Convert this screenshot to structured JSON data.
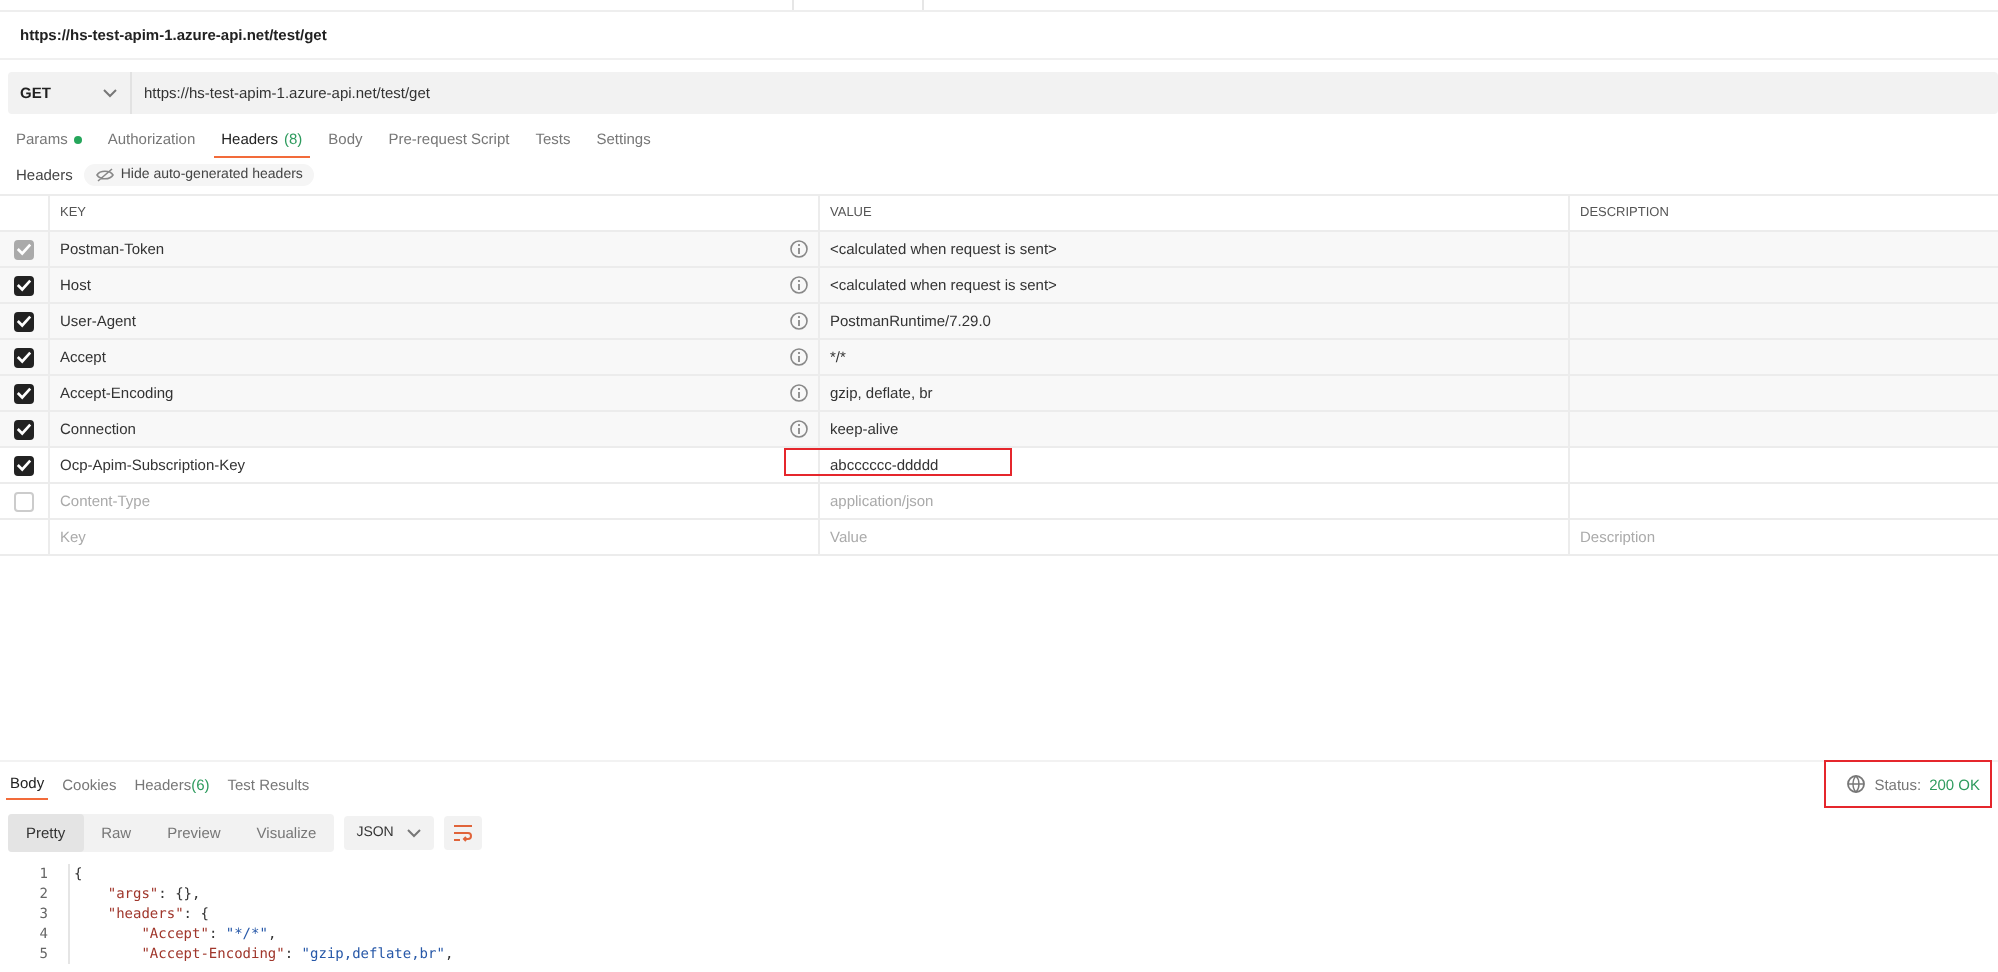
{
  "request_title": "https://hs-test-apim-1.azure-api.net/test/get",
  "url_bar": {
    "method": "GET",
    "url": "https://hs-test-apim-1.azure-api.net/test/get"
  },
  "request_tabs": [
    {
      "label": "Params",
      "dot": true,
      "selected": false
    },
    {
      "label": "Authorization",
      "dot": false,
      "selected": false
    },
    {
      "label": "Headers",
      "count": "(8)",
      "dot": false,
      "selected": true
    },
    {
      "label": "Body",
      "dot": false,
      "selected": false
    },
    {
      "label": "Pre-request Script",
      "dot": false,
      "selected": false
    },
    {
      "label": "Tests",
      "dot": false,
      "selected": false
    },
    {
      "label": "Settings",
      "dot": false,
      "selected": false
    }
  ],
  "headers_bar": {
    "label": "Headers",
    "toggle": "Hide auto-generated headers"
  },
  "table": {
    "columns": [
      "KEY",
      "VALUE",
      "DESCRIPTION"
    ],
    "rows": [
      {
        "key": "Postman-Token",
        "value": "<calculated when request is sent>",
        "checked": true,
        "disabled": true,
        "auto": true,
        "highlighted": false
      },
      {
        "key": "Host",
        "value": "<calculated when request is sent>",
        "checked": true,
        "disabled": false,
        "auto": true,
        "highlighted": false
      },
      {
        "key": "User-Agent",
        "value": "PostmanRuntime/7.29.0",
        "checked": true,
        "disabled": false,
        "auto": true,
        "highlighted": false
      },
      {
        "key": "Accept",
        "value": "*/*",
        "checked": true,
        "disabled": false,
        "auto": true,
        "highlighted": false
      },
      {
        "key": "Accept-Encoding",
        "value": "gzip, deflate, br",
        "checked": true,
        "disabled": false,
        "auto": true,
        "highlighted": false
      },
      {
        "key": "Connection",
        "value": "keep-alive",
        "checked": true,
        "disabled": false,
        "auto": true,
        "highlighted": false
      },
      {
        "key": "Ocp-Apim-Subscription-Key",
        "value": "abcccccc-ddddd",
        "checked": true,
        "disabled": false,
        "auto": false,
        "highlighted": true
      },
      {
        "key": "Content-Type",
        "value": "application/json",
        "checked": false,
        "disabled": false,
        "auto": false,
        "highlighted": false
      }
    ],
    "new_row": {
      "key_placeholder": "Key",
      "value_placeholder": "Value",
      "description_placeholder": "Description"
    }
  },
  "response_tabs": [
    {
      "label": "Body",
      "selected": true
    },
    {
      "label": "Cookies",
      "selected": false
    },
    {
      "label": "Headers",
      "count": "(6)",
      "selected": false
    },
    {
      "label": "Test Results",
      "selected": false
    }
  ],
  "status": {
    "label": "Status:",
    "value": "200 OK",
    "highlighted": true
  },
  "view_modes": [
    {
      "label": "Pretty",
      "selected": true
    },
    {
      "label": "Raw",
      "selected": false
    },
    {
      "label": "Preview",
      "selected": false
    },
    {
      "label": "Visualize",
      "selected": false
    }
  ],
  "format": "JSON",
  "code_lines": [
    {
      "number": "1",
      "tokens": [
        {
          "kind": "punct",
          "text": "{"
        }
      ]
    },
    {
      "number": "2",
      "tokens": [
        {
          "kind": "key",
          "text": "    \"args\""
        },
        {
          "kind": "punct",
          "text": ": {},"
        }
      ]
    },
    {
      "number": "3",
      "tokens": [
        {
          "kind": "key",
          "text": "    \"headers\""
        },
        {
          "kind": "punct",
          "text": ": {"
        }
      ]
    },
    {
      "number": "4",
      "tokens": [
        {
          "kind": "key",
          "text": "        \"Accept\""
        },
        {
          "kind": "punct",
          "text": ": "
        },
        {
          "kind": "string",
          "text": "\"*/*\""
        },
        {
          "kind": "punct",
          "text": ","
        }
      ]
    },
    {
      "number": "5",
      "tokens": [
        {
          "kind": "key",
          "text": "        \"Accept-Encoding\""
        },
        {
          "kind": "punct",
          "text": ": "
        },
        {
          "kind": "string",
          "text": "\"gzip,deflate,br\""
        },
        {
          "kind": "punct",
          "text": ","
        }
      ]
    }
  ]
}
